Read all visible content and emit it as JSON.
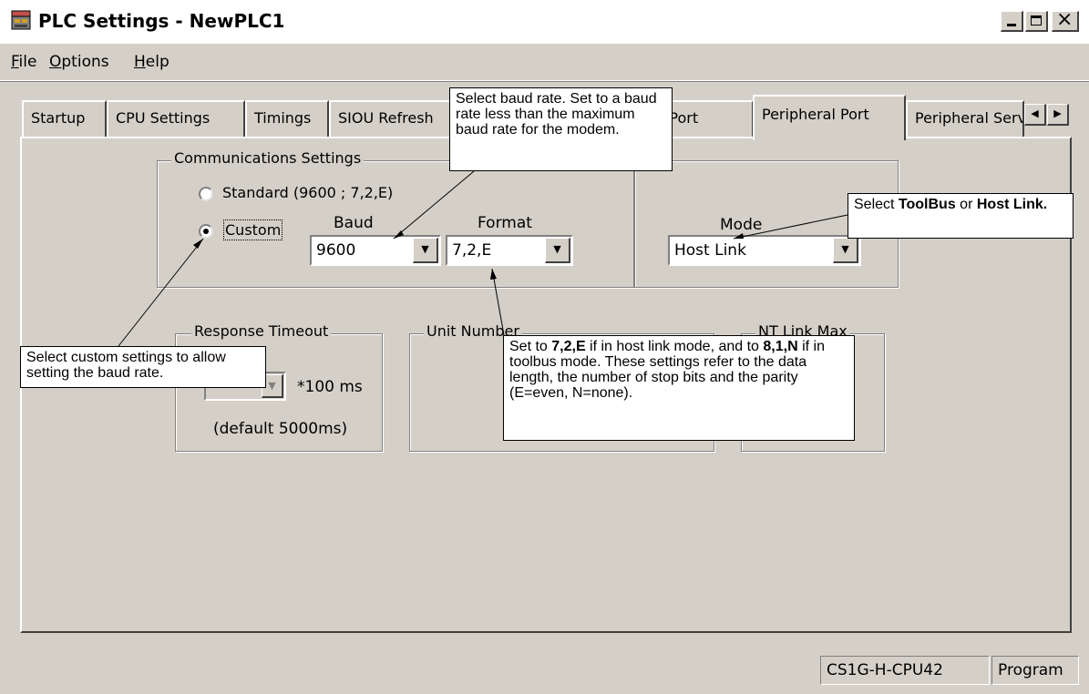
{
  "window": {
    "title": "PLC Settings - NewPLC1"
  },
  "menu": [
    {
      "accel": "F",
      "rest": "ile"
    },
    {
      "accel": "O",
      "rest": "ptions"
    },
    {
      "accel": "H",
      "rest": "elp"
    }
  ],
  "tabs": [
    "Startup",
    "CPU Settings",
    "Timings",
    "SIOU Refresh",
    "Host Link Port",
    "Peripheral Port",
    "Peripheral Service"
  ],
  "communications": {
    "group_label": "Communications Settings",
    "standard_label": "Standard (9600 ; 7,2,E)",
    "custom_label": "Custom",
    "baud_label": "Baud",
    "baud_value": "9600",
    "format_label": "Format",
    "format_value": "7,2,E"
  },
  "mode": {
    "label": "Mode",
    "value": "Host Link"
  },
  "response_timeout": {
    "label": "Response Timeout",
    "unit": "*100 ms",
    "default": "(default 5000ms)"
  },
  "unit_number": {
    "label": "Unit Number"
  },
  "nt_link": {
    "label": "NT Link Max"
  },
  "status": {
    "cpu": "CS1G-H-CPU42",
    "mode": "Program"
  },
  "annotations": {
    "baud": "Select baud rate. Set to a baud rate less than the maximum baud rate for the modem.",
    "mode_pre": "Select ",
    "mode_b1": "ToolBus",
    "mode_mid": " or ",
    "mode_b2": "Host Link.",
    "custom": "Select custom settings to allow setting the baud rate.",
    "format_b1": "7,2,E",
    "format_t1": " if in host link mode, and to ",
    "format_pre": "Set to ",
    "format_b2": "8,1,N",
    "format_t2": " if in toolbus mode. These settings refer to the data length, the number of stop bits and the parity (E=even, N=none)."
  }
}
